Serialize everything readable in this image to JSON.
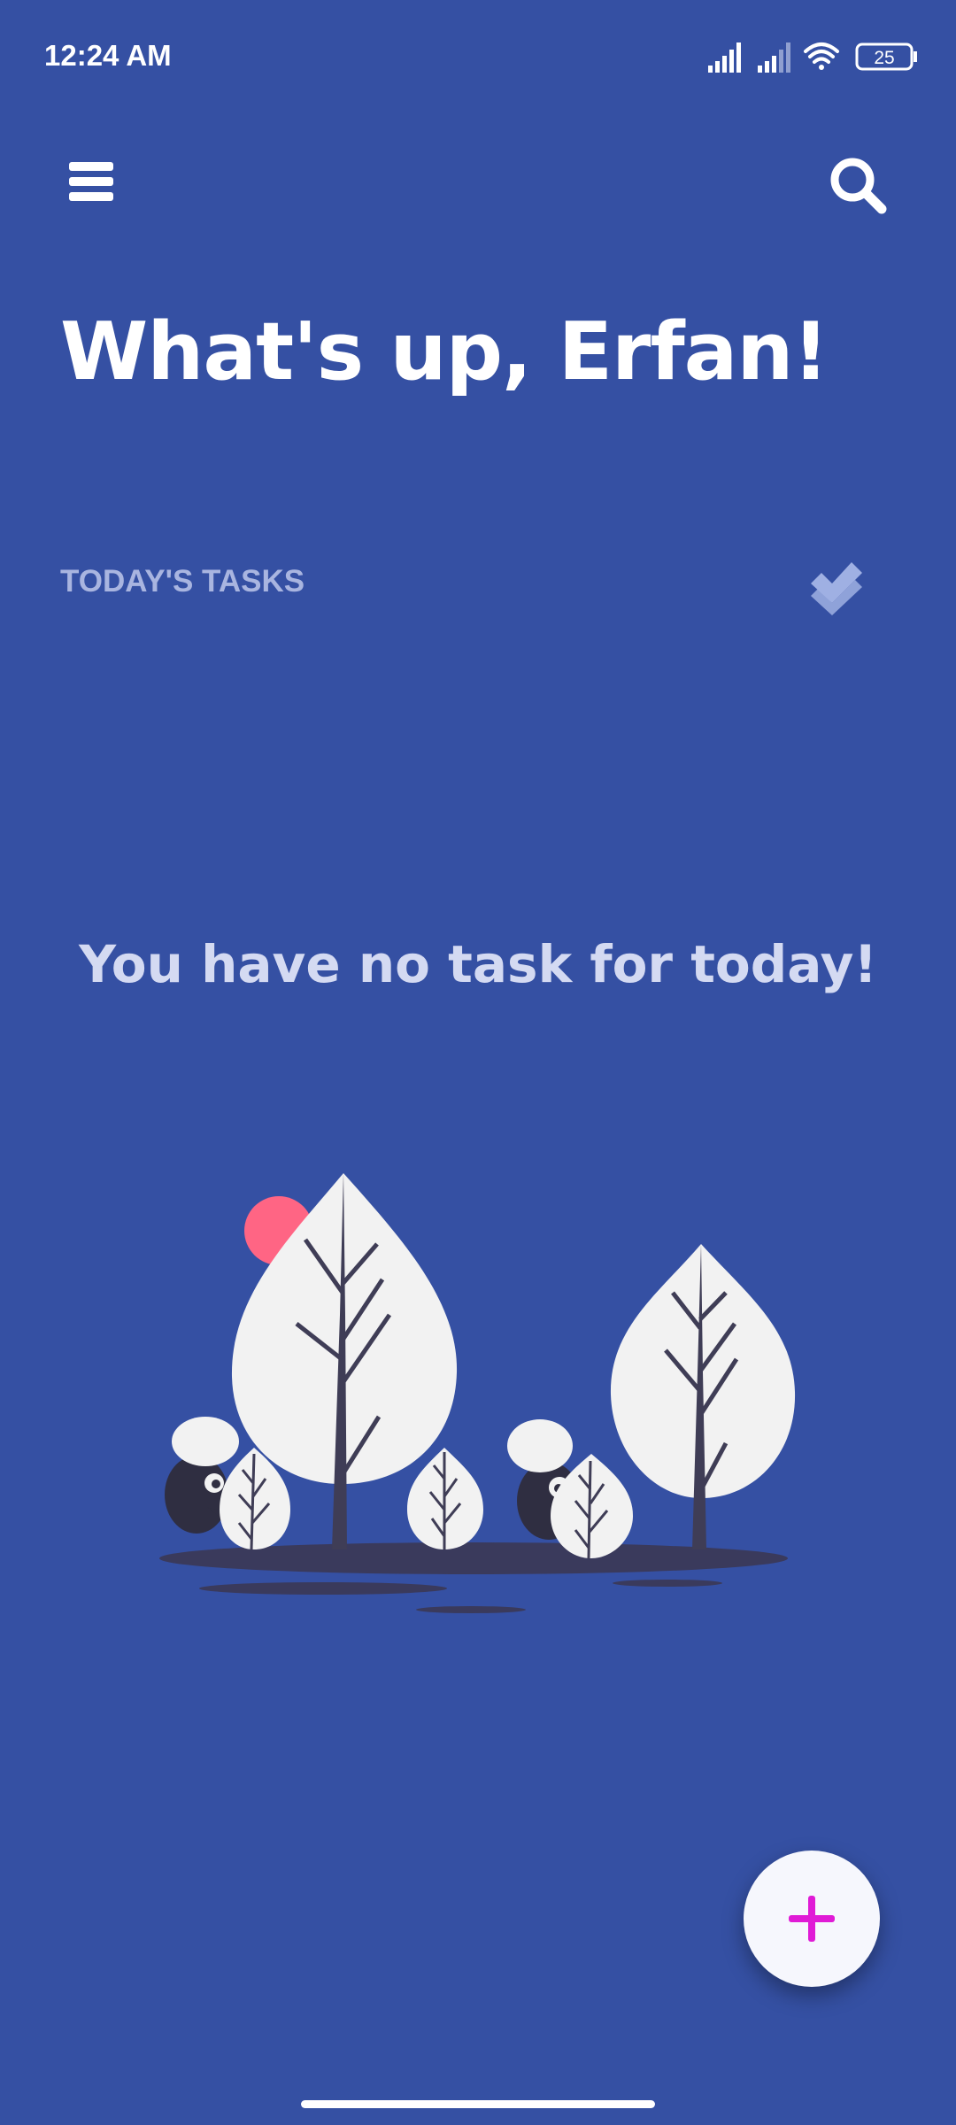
{
  "status_bar": {
    "time": "12:24 AM",
    "battery": "25",
    "icons": [
      "signal-icon",
      "signal-icon",
      "wifi-icon",
      "battery-icon"
    ]
  },
  "app_bar": {
    "menu_icon": "menu-icon",
    "search_icon": "search-icon"
  },
  "greeting": "What's up, Erfan!",
  "section": {
    "label": "TODAY'S TASKS",
    "icon": "double-check-icon"
  },
  "empty_state": {
    "message": "You have no task for today!",
    "illustration": "trees-illustration"
  },
  "fab": {
    "icon": "plus-icon"
  },
  "colors": {
    "background": "#3550a3",
    "accent": "#e01bd6",
    "sun": "#ff6584",
    "label": "#a9b5e0"
  }
}
